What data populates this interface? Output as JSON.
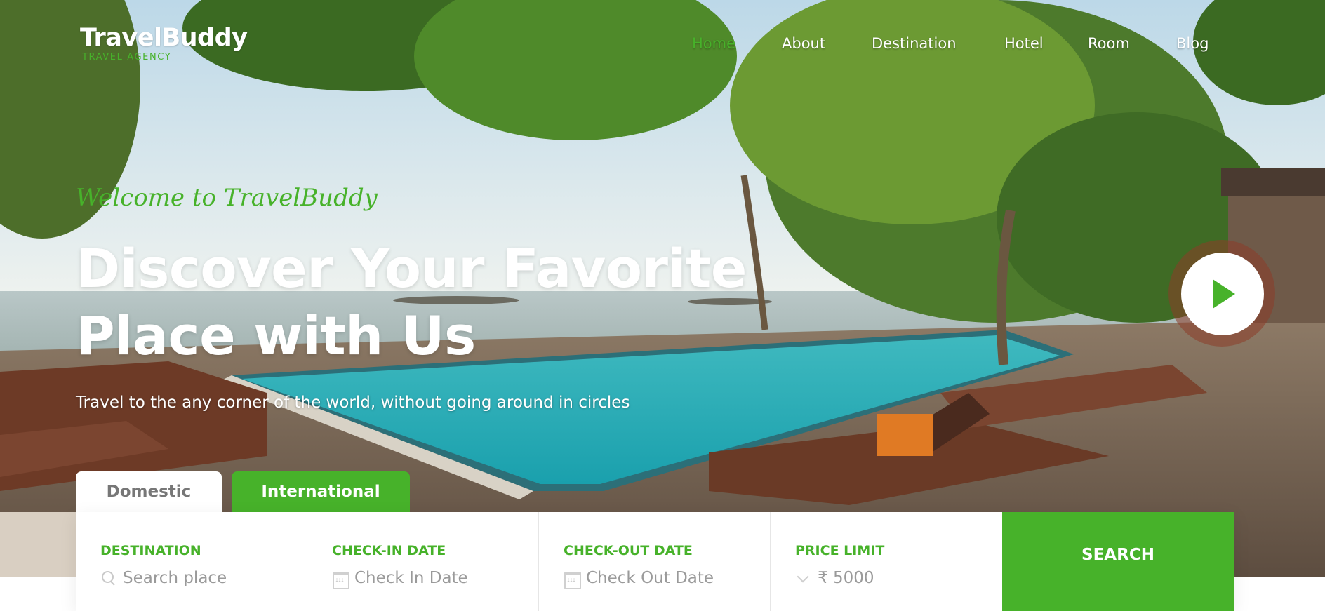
{
  "brand": {
    "name": "TravelBuddy",
    "tagline": "TRAVEL AGENCY"
  },
  "nav": {
    "items": [
      {
        "label": "Home",
        "active": true
      },
      {
        "label": "About",
        "active": false
      },
      {
        "label": "Destination",
        "active": false
      },
      {
        "label": "Hotel",
        "active": false
      },
      {
        "label": "Room",
        "active": false
      },
      {
        "label": "Blog",
        "active": false
      }
    ]
  },
  "hero": {
    "welcome": "Welcome to TravelBuddy",
    "headline_line1": "Discover Your Favorite",
    "headline_line2": "Place with Us",
    "subtitle": "Travel to the any corner of the world, without going around in circles",
    "play_icon": "play-icon"
  },
  "tabs": {
    "domestic": "Domestic",
    "international": "International"
  },
  "search": {
    "destination": {
      "label": "DESTINATION",
      "placeholder": "Search place",
      "icon": "search-icon"
    },
    "checkin": {
      "label": "CHECK-IN DATE",
      "placeholder": "Check In Date",
      "icon": "calendar-icon"
    },
    "checkout": {
      "label": "CHECK-OUT DATE",
      "placeholder": "Check Out Date",
      "icon": "calendar-icon"
    },
    "price": {
      "label": "PRICE LIMIT",
      "value": "₹ 5000",
      "icon": "chevron-down-icon"
    },
    "button_label": "SEARCH"
  },
  "colors": {
    "accent": "#47b22a",
    "text_light": "#ffffff",
    "placeholder": "#9a9a9a"
  }
}
